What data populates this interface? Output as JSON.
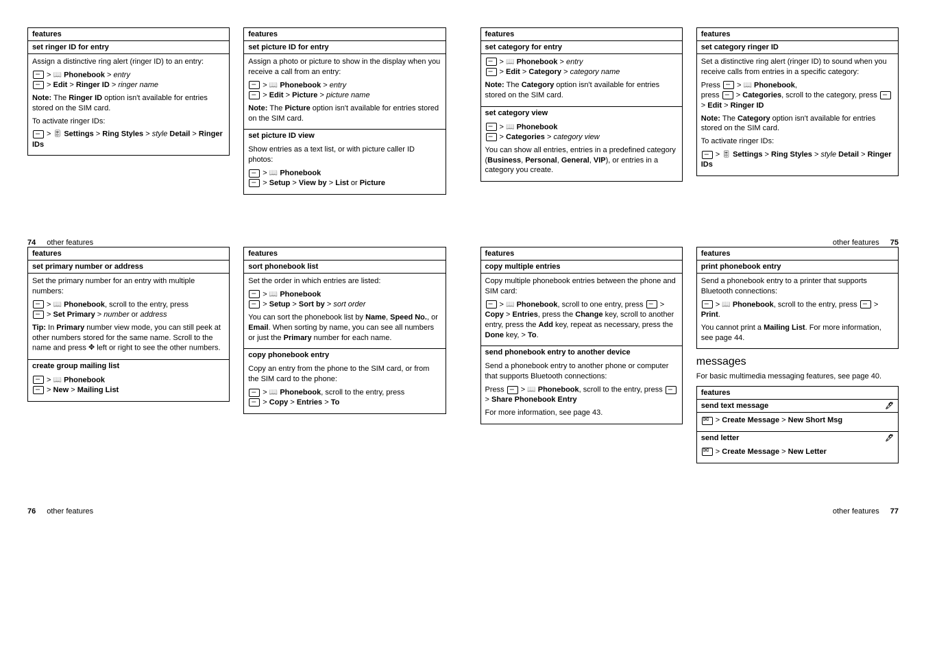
{
  "p74": {
    "col1": {
      "h": "features",
      "sub": "set ringer ID for entry",
      "t1": "Assign a distinctive ring alert (ringer ID) to an entry:",
      "path1a": "Phonebook",
      "path1b": "entry",
      "path2a": "Edit",
      "path2b": "Ringer ID",
      "path2c": "ringer name",
      "note": "Note: ",
      "noteT": "The ",
      "noteB": "Ringer ID",
      "noteE": " option isn't available for entries stored on the SIM card.",
      "t2": "To activate ringer IDs:",
      "p3a": "Settings",
      "p3b": "Ring Styles",
      "p3c": "style",
      "p3d": "Detail",
      "p3e": "Ringer IDs"
    },
    "col2": {
      "h": "features",
      "sub": "set picture ID for entry",
      "t1": "Assign a photo or picture to show in the display when you receive a call from an entry:",
      "p1": "Phonebook",
      "p1b": "entry",
      "p2a": "Edit",
      "p2b": "Picture",
      "p2c": "picture name",
      "note": "Note: ",
      "noteT": "The ",
      "noteB": "Picture",
      "noteE": " option isn't available for entries stored on the SIM card.",
      "sub2": "set picture ID view",
      "t2": "Show entries as a text list, or with picture caller ID photos:",
      "p3": "Phonebook",
      "p4a": "Setup",
      "p4b": "View by",
      "p4c": "List",
      "p4d": "Picture"
    },
    "footerL": "other features",
    "pageL": "74"
  },
  "p75": {
    "col1": {
      "h": "features",
      "sub": "set category for entry",
      "p1": "Phonebook",
      "p1b": "entry",
      "p2a": "Edit",
      "p2b": "Category",
      "p2c": "category name",
      "note": "Note: ",
      "noteT": "The ",
      "noteB": "Category",
      "noteE": " option isn't available for entries stored on the SIM card.",
      "sub2": "set category view",
      "p3": "Phonebook",
      "p4a": "Categories",
      "p4b": "category view",
      "t1": "You can show all entries, entries in a predefined category (",
      "b1": "Business",
      "c": ", ",
      "b2": "Personal",
      "b3": "General",
      "b4": "VIP",
      "t1e": "), or entries in a category you create."
    },
    "col2": {
      "h": "features",
      "sub": "set category ringer ID",
      "t1": "Set a distinctive ring alert (ringer ID) to sound when you receive calls from entries in a specific category:",
      "t2a": "Press ",
      "p1": "Phonebook",
      "t2b": ",",
      "t3a": "press ",
      "p2": "Categories",
      "t3b": ", scroll to the category, press ",
      "p3a": "Edit",
      "p3b": "Ringer ID",
      "note": "Note: ",
      "noteT": "The ",
      "noteB": "Category",
      "noteE": " option isn't available for entries stored on the SIM card.",
      "t4": "To activate ringer IDs:",
      "p4a": "Settings",
      "p4b": "Ring Styles",
      "p4c": "style",
      "p4d": "Detail",
      "p4e": "Ringer IDs"
    },
    "footerR": "other features",
    "pageR": "75"
  },
  "p76": {
    "col1": {
      "h": "features",
      "sub": "set primary number or address",
      "t1": "Set the primary number for an entry with multiple numbers:",
      "p1": "Phonebook",
      "t2": ", scroll to the entry, press ",
      "p2a": "Set Primary",
      "p2b": "number",
      "p2c": "address",
      "tip": "Tip: ",
      "tipT1": "In ",
      "tipB": "Primary",
      "tipT2": " number view mode, you can still peek at other numbers stored for the same name. Scroll to the name and press ",
      "tipT3": " left or right to see the other numbers.",
      "sub2": "create group mailing list",
      "p3": "Phonebook",
      "p4a": "New",
      "p4b": "Mailing List"
    },
    "col2": {
      "h": "features",
      "sub": "sort phonebook list",
      "t1": "Set the order in which entries are listed:",
      "p1": "Phonebook",
      "p2a": "Setup",
      "p2b": "Sort by",
      "p2c": "sort order",
      "t2a": "You can sort the phonebook list by ",
      "b1": "Name",
      "c": ", ",
      "b2": "Speed No.",
      "t2b": ", or ",
      "b3": "Email",
      "t2c": ". When sorting by name, you can see all numbers or just the ",
      "b4": "Primary",
      "t2d": " number for each name.",
      "sub2": "copy phonebook entry",
      "t3": "Copy an entry from the phone to the SIM card, or from the SIM card to the phone:",
      "p3": "Phonebook",
      "t4": ", scroll to the entry, press ",
      "p4a": "Copy",
      "p4b": "Entries",
      "p4c": "To"
    },
    "footerL": "other features",
    "pageL": "76"
  },
  "p77": {
    "col1": {
      "h": "features",
      "sub": "copy multiple entries",
      "t1": "Copy multiple phonebook entries between the phone and SIM card:",
      "p1": "Phonebook",
      "t2": ", scroll to one entry, press ",
      "p2a": "Copy",
      "p2b": "Entries",
      "t3": ", press the ",
      "b1": "Change",
      "t4": " key, scroll to another entry, press the ",
      "b2": "Add",
      "t5": " key, repeat as necessary, press the ",
      "b3": "Done",
      "t6": " key, > ",
      "b4": "To",
      "t7": ".",
      "sub2": "send phonebook entry to another device",
      "t8": "Send a phonebook entry to another phone or computer that supports Bluetooth connections:",
      "t9a": "Press ",
      "p3": "Phonebook",
      "t9b": ", scroll to the entry, press ",
      "p4": "Share Phonebook Entry",
      "t10": "For more information, see page 43."
    },
    "col2": {
      "h": "features",
      "sub": "print phonebook entry",
      "t1": "Send a phonebook entry to a printer that supports Bluetooth connections:",
      "p1": "Phonebook",
      "t2": ", scroll to the entry, press ",
      "p2": "Print",
      "t3": ".",
      "t4a": "You cannot print a ",
      "b1": "Mailing List",
      "t4b": ". For more information, see page 44.",
      "sec": "messages",
      "t5": "For basic multimedia messaging features, see page 40.",
      "mh": "features",
      "m1": "send text message",
      "m1a": "Create Message",
      "m1b": "New Short Msg",
      "m2": "send letter",
      "m2a": "Create Message",
      "m2b": "New Letter"
    },
    "footerR": "other features",
    "pageR": "77"
  }
}
